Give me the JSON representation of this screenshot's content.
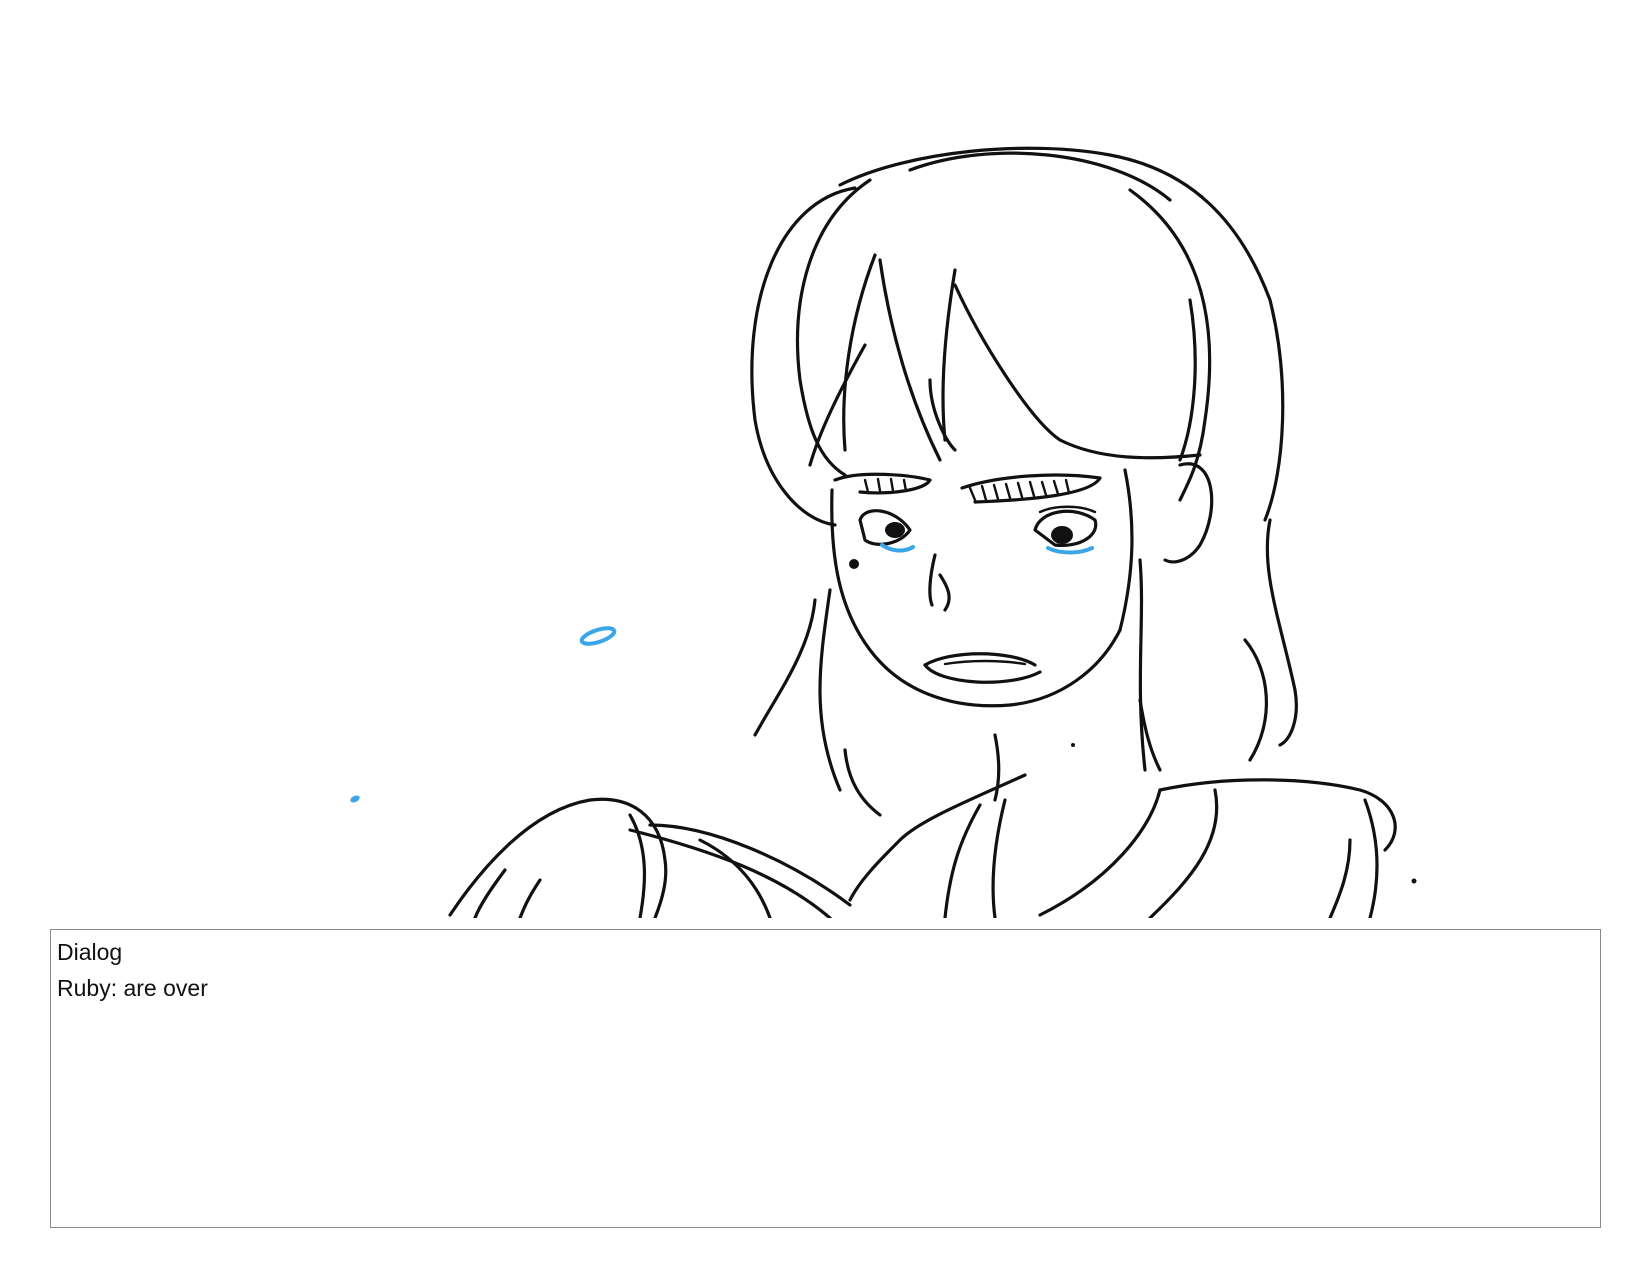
{
  "dialog": {
    "heading": "Dialog",
    "line": "Ruby: are over"
  },
  "panel": {
    "subject": "sketch-girl-crying",
    "ink_color": "#111111",
    "tear_color": "#3aa6e8"
  }
}
